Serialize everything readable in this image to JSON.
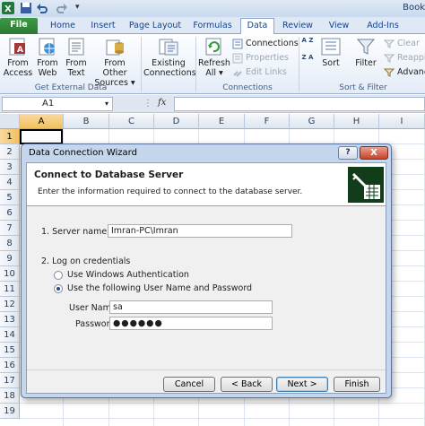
{
  "window": {
    "title": "Book"
  },
  "tabs": [
    {
      "label": "File"
    },
    {
      "label": "Home"
    },
    {
      "label": "Insert"
    },
    {
      "label": "Page Layout"
    },
    {
      "label": "Formulas"
    },
    {
      "label": "Data"
    },
    {
      "label": "Review"
    },
    {
      "label": "View"
    },
    {
      "label": "Add-Ins"
    }
  ],
  "ribbon": {
    "external": {
      "label": "Get External Data",
      "buttons": [
        {
          "label1": "From",
          "label2": "Access"
        },
        {
          "label1": "From",
          "label2": "Web"
        },
        {
          "label1": "From",
          "label2": "Text"
        },
        {
          "label1": "From Other",
          "label2": "Sources ▾"
        }
      ]
    },
    "existing": {
      "label1": "Existing",
      "label2": "Connections"
    },
    "connections": {
      "label": "Connections",
      "refresh1": "Refresh",
      "refresh2": "All ▾",
      "items": [
        "Connections",
        "Properties",
        "Edit Links"
      ]
    },
    "sort": {
      "label": "Sort & Filter",
      "sort_az": "A Z",
      "sort_za": "Z A",
      "sort_label": "Sort",
      "filter_label": "Filter",
      "items": [
        "Clear",
        "Reapply",
        "Advanc"
      ]
    }
  },
  "formula_bar": {
    "cell_ref": "A1",
    "fx": "fx",
    "value": ""
  },
  "grid": {
    "columns": [
      "A",
      "B",
      "C",
      "D",
      "E",
      "F",
      "G",
      "H",
      "I"
    ],
    "rows": [
      "1",
      "2",
      "3",
      "4",
      "5",
      "6",
      "7",
      "8",
      "9",
      "10",
      "11",
      "12",
      "13",
      "14",
      "15",
      "16",
      "17",
      "18",
      "19"
    ]
  },
  "dialog": {
    "title": "Data Connection Wizard",
    "help": "?",
    "close": "X",
    "heading": "Connect to Database Server",
    "subtitle": "Enter the information required to connect to the database server.",
    "server_label": "1. Server name:",
    "server_value": "Imran-PC\\Imran",
    "logon_label": "2. Log on credentials",
    "radio_windows": "Use Windows Authentication",
    "radio_userpass": "Use the following User Name and Password",
    "username_label": "User Name:",
    "username_value": "sa",
    "password_label": "Password:",
    "password_value": "●●●●●●",
    "buttons": {
      "cancel": "Cancel",
      "back": "< Back",
      "next": "Next >",
      "finish": "Finish"
    }
  },
  "colors": {
    "file_tab": "#2a7a32",
    "ribbon_text": "#15428b",
    "dialog_frame": "#c4d6ec"
  }
}
